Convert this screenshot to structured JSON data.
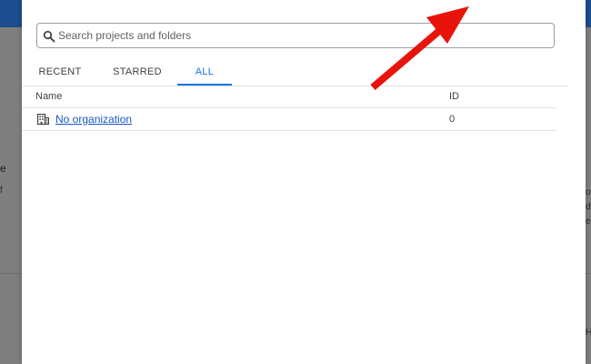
{
  "search": {
    "placeholder": "Search projects and folders",
    "value": ""
  },
  "tabs": [
    {
      "label": "RECENT"
    },
    {
      "label": "STARRED"
    },
    {
      "label": "ALL"
    }
  ],
  "active_tab": "ALL",
  "table": {
    "columns": [
      "Name",
      "ID"
    ],
    "rows": [
      {
        "name": "No organization",
        "id": "0",
        "icon": "organization-icon"
      }
    ]
  },
  "background_fragments": {
    "left_letter": "e",
    "left_small": "f",
    "right_small_1": "o",
    "right_small_2": "d",
    "right_small_3": "e",
    "right_small_4": "H"
  },
  "colors": {
    "accent": "#1a73e8",
    "link": "#1a56c8",
    "annotation_arrow": "#e8140c",
    "topbar": "#1c4d8e"
  },
  "icons": [
    "search-icon",
    "organization-icon",
    "red-arrow-annotation"
  ]
}
